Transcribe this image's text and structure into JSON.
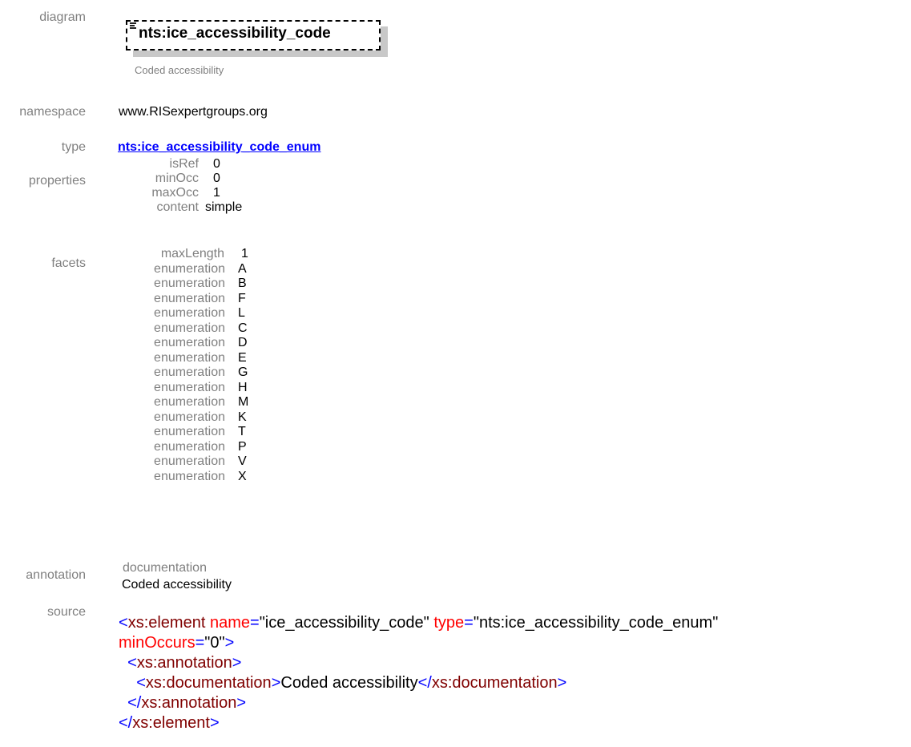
{
  "labels": {
    "diagram": "diagram",
    "namespace": "namespace",
    "type": "type",
    "properties": "properties",
    "facets": "facets",
    "annotation": "annotation",
    "source": "source"
  },
  "diagram": {
    "element_name": "nts:ice_accessibility_code",
    "documentation": "Coded accessibility"
  },
  "namespace": "www.RISexpertgroups.org",
  "type": "nts:ice_accessibility_code_enum",
  "properties": [
    {
      "key": "isRef",
      "value": "0"
    },
    {
      "key": "minOcc",
      "value": "0"
    },
    {
      "key": "maxOcc",
      "value": "1"
    },
    {
      "key": "content",
      "value": "simple"
    }
  ],
  "facets": [
    {
      "key": "maxLength",
      "value": "1"
    },
    {
      "key": "enumeration",
      "value": "A"
    },
    {
      "key": "enumeration",
      "value": "B"
    },
    {
      "key": "enumeration",
      "value": "F"
    },
    {
      "key": "enumeration",
      "value": "L"
    },
    {
      "key": "enumeration",
      "value": "C"
    },
    {
      "key": "enumeration",
      "value": "D"
    },
    {
      "key": "enumeration",
      "value": "E"
    },
    {
      "key": "enumeration",
      "value": "G"
    },
    {
      "key": "enumeration",
      "value": "H"
    },
    {
      "key": "enumeration",
      "value": "M"
    },
    {
      "key": "enumeration",
      "value": "K"
    },
    {
      "key": "enumeration",
      "value": "T"
    },
    {
      "key": "enumeration",
      "value": "P"
    },
    {
      "key": "enumeration",
      "value": "V"
    },
    {
      "key": "enumeration",
      "value": "X"
    }
  ],
  "annotation": {
    "key": "documentation",
    "value": "Coded accessibility"
  },
  "source": {
    "element_open": "xs:element",
    "attr_name": "name",
    "attr_name_value": "\"ice_accessibility_code\"",
    "attr_type": "type",
    "attr_type_value": "\"nts:ice_accessibility_code_enum\"",
    "attr_min": "minOccurs",
    "attr_min_value": "\"0\"",
    "annotation_tag": "xs:annotation",
    "documentation_tag": "xs:documentation",
    "documentation_text": "Coded accessibility",
    "documentation_close": "xs:documentation",
    "annotation_close": "xs:annotation",
    "element_close": "xs:element"
  },
  "colors": {
    "label": "#808080",
    "link": "#0000ff",
    "xml_bracket": "#0000ff",
    "xml_tag": "#800000",
    "xml_attr": "#ff0000"
  }
}
